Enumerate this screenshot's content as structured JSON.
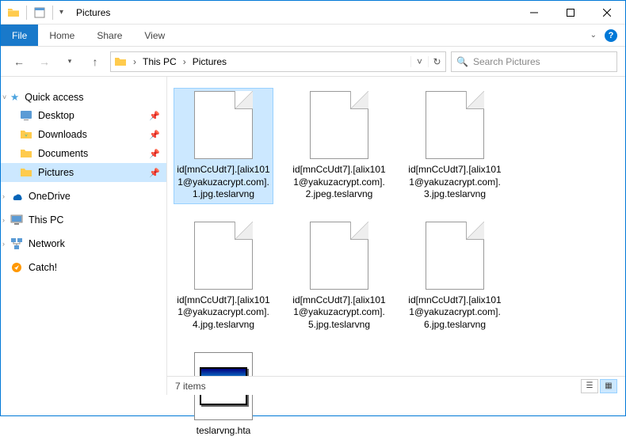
{
  "titlebar": {
    "title": "Pictures"
  },
  "ribbon": {
    "file": "File",
    "tabs": [
      "Home",
      "Share",
      "View"
    ]
  },
  "breadcrumb": {
    "items": [
      "This PC",
      "Pictures"
    ]
  },
  "search": {
    "placeholder": "Search Pictures"
  },
  "sidebar": {
    "quick_access": {
      "label": "Quick access",
      "items": [
        {
          "label": "Desktop",
          "pinned": true,
          "icon": "desktop"
        },
        {
          "label": "Downloads",
          "pinned": true,
          "icon": "downloads"
        },
        {
          "label": "Documents",
          "pinned": true,
          "icon": "documents"
        },
        {
          "label": "Pictures",
          "pinned": true,
          "icon": "pictures",
          "selected": true
        }
      ]
    },
    "locations": [
      {
        "label": "OneDrive",
        "icon": "onedrive"
      },
      {
        "label": "This PC",
        "icon": "thispc"
      },
      {
        "label": "Network",
        "icon": "network"
      },
      {
        "label": "Catch!",
        "icon": "catch"
      }
    ]
  },
  "files": [
    {
      "name": "id[mnCcUdt7].[alix1011@yakuzacrypt.com].1.jpg.teslarvng",
      "type": "file",
      "selected": true
    },
    {
      "name": "id[mnCcUdt7].[alix1011@yakuzacrypt.com].2.jpeg.teslarvng",
      "type": "file"
    },
    {
      "name": "id[mnCcUdt7].[alix1011@yakuzacrypt.com].3.jpg.teslarvng",
      "type": "file"
    },
    {
      "name": "id[mnCcUdt7].[alix1011@yakuzacrypt.com].4.jpg.teslarvng",
      "type": "file"
    },
    {
      "name": "id[mnCcUdt7].[alix1011@yakuzacrypt.com].5.jpg.teslarvng",
      "type": "file"
    },
    {
      "name": "id[mnCcUdt7].[alix1011@yakuzacrypt.com].6.jpg.teslarvng",
      "type": "file"
    },
    {
      "name": "teslarvng.hta",
      "type": "hta"
    }
  ],
  "status": {
    "count": "7 items"
  }
}
